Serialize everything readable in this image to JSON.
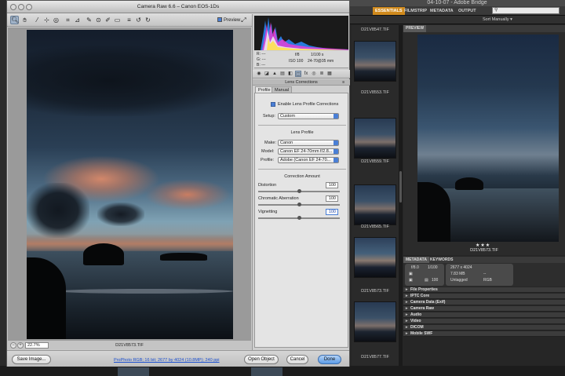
{
  "bridge": {
    "window_title": "04-10-07 - Adobe Bridge",
    "workspaces": [
      "ESSENTIALS",
      "FILMSTRIP",
      "METADATA",
      "OUTPUT"
    ],
    "active_workspace": "ESSENTIALS",
    "sort_label": "Sort Manually",
    "content_files": [
      {
        "name": "D21V8547.TIF",
        "selected": false
      },
      {
        "name": "D21V8553.TIF",
        "selected": false
      },
      {
        "name": "D21V8559.TIF",
        "selected": false
      },
      {
        "name": "D21V8565.TIF",
        "selected": false
      },
      {
        "name": "D21V8573.TIF",
        "selected": true
      },
      {
        "name": "D21V8577.TIF",
        "selected": false
      }
    ],
    "preview": {
      "tab_label": "PREVIEW",
      "rating_stars": "★★★",
      "file_name": "D21V8573.TIF"
    },
    "metadata": {
      "tabs": [
        "METADATA",
        "KEYWORDS"
      ],
      "aperture": "f/8.0",
      "shutter": "1/100",
      "iso": "100",
      "dimensions": "2677 x 4024",
      "file_size": "7.83 MB",
      "dash": "--",
      "tag": "Untagged",
      "color_mode": "RGB",
      "sections": [
        "File Properties",
        "IPTC Core",
        "Camera Data (Exif)",
        "Camera Raw",
        "Audio",
        "Video",
        "DICOM",
        "Mobile SWF"
      ]
    }
  },
  "camera_raw": {
    "title": "Camera Raw 6.6  –  Canon EOS-1Ds",
    "preview_label": "Preview",
    "zoom": "22.7%",
    "file_name": "D21V8573.TIF",
    "workflow": "ProPhoto RGB; 16 bit; 2677 by 4024 (10.8MP); 240 ppi",
    "buttons": {
      "save": "Save Image...",
      "open": "Open Object",
      "cancel": "Cancel",
      "done": "Done"
    },
    "histogram_info": {
      "r": "R:  ---",
      "g": "G:  ---",
      "b": "B:  ---",
      "aperture": "f/8",
      "shutter": "1/100 s",
      "iso": "ISO 100",
      "lens": "24-70@35 mm"
    },
    "panel": {
      "title": "Lens Corrections",
      "tabs": [
        "Profile",
        "Manual"
      ],
      "enable_label": "Enable Lens Profile Corrections",
      "setup_label": "Setup:",
      "setup_value": "Custom",
      "lens_profile_title": "Lens Profile",
      "make_label": "Make:",
      "make_value": "Canon",
      "model_label": "Model:",
      "model_value": "Canon EF 24-70mm f/2.8...",
      "profile_label": "Profile:",
      "profile_value": "Adobe (Canon EF 24-70...",
      "correction_title": "Correction Amount",
      "sliders": [
        {
          "label": "Distortion",
          "value": "100",
          "level": 1.0
        },
        {
          "label": "Chromatic Aberration",
          "value": "100",
          "level": 1.0
        },
        {
          "label": "Vignetting",
          "value": "100",
          "level": 1.0
        }
      ]
    }
  }
}
